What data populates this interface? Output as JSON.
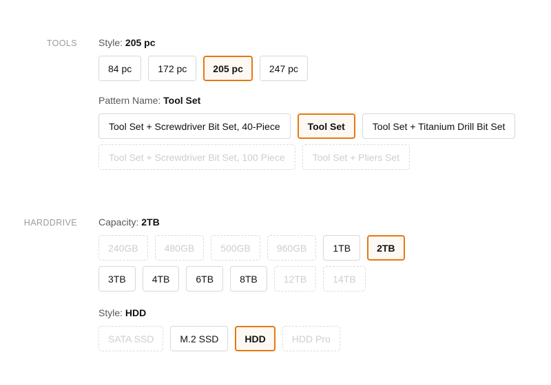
{
  "sections": [
    {
      "label": "TOOLS",
      "groups": [
        {
          "name": "style-tools",
          "label": "Style:",
          "value": "205 pc",
          "rows": [
            [
              {
                "label": "84 pc",
                "state": "normal"
              },
              {
                "label": "172 pc",
                "state": "normal"
              },
              {
                "label": "205 pc",
                "state": "selected"
              },
              {
                "label": "247 pc",
                "state": "normal"
              }
            ]
          ]
        },
        {
          "name": "pattern-name",
          "label": "Pattern Name:",
          "value": "Tool Set",
          "rows": [
            [
              {
                "label": "Tool Set + Screwdriver Bit Set, 40-Piece",
                "state": "normal"
              },
              {
                "label": "Tool Set",
                "state": "selected"
              },
              {
                "label": "Tool Set + Titanium Drill Bit Set",
                "state": "normal"
              }
            ],
            [
              {
                "label": "Tool Set + Screwdriver Bit Set, 100 Piece",
                "state": "disabled"
              },
              {
                "label": "Tool Set + Pliers Set",
                "state": "disabled"
              }
            ]
          ]
        }
      ]
    },
    {
      "label": "HARDDRIVE",
      "groups": [
        {
          "name": "capacity",
          "label": "Capacity:",
          "value": "2TB",
          "rows": [
            [
              {
                "label": "240GB",
                "state": "disabled"
              },
              {
                "label": "480GB",
                "state": "disabled"
              },
              {
                "label": "500GB",
                "state": "disabled"
              },
              {
                "label": "960GB",
                "state": "disabled"
              },
              {
                "label": "1TB",
                "state": "normal"
              },
              {
                "label": "2TB",
                "state": "selected"
              }
            ],
            [
              {
                "label": "3TB",
                "state": "normal"
              },
              {
                "label": "4TB",
                "state": "normal"
              },
              {
                "label": "6TB",
                "state": "normal"
              },
              {
                "label": "8TB",
                "state": "normal"
              },
              {
                "label": "12TB",
                "state": "disabled"
              },
              {
                "label": "14TB",
                "state": "disabled"
              }
            ]
          ]
        },
        {
          "name": "style-harddrive",
          "label": "Style:",
          "value": "HDD",
          "rows": [
            [
              {
                "label": "SATA SSD",
                "state": "disabled"
              },
              {
                "label": "M.2 SSD",
                "state": "normal"
              },
              {
                "label": "HDD",
                "state": "selected"
              },
              {
                "label": "HDD Pro",
                "state": "disabled"
              }
            ]
          ]
        }
      ]
    }
  ],
  "colors": {
    "selected_border": "#e47911",
    "selected_background": "#fdf8f2",
    "normal_border": "#d5d9d9",
    "disabled_border": "#d9dcdc",
    "disabled_text": "#cbcfcf",
    "label_text": "#565959",
    "value_text": "#0f1111",
    "section_label_text": "#999c9c",
    "page_background": "#ffffff"
  }
}
